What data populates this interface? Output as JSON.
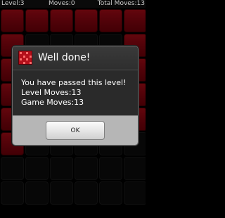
{
  "status_bar": {
    "level": "Level:3",
    "moves": "Moves:0",
    "total_moves": "Total Moves:13"
  },
  "board": {
    "rows": 8,
    "cols": 6,
    "cells": [
      [
        1,
        1,
        1,
        1,
        1,
        1
      ],
      [
        1,
        0,
        0,
        0,
        0,
        1
      ],
      [
        1,
        0,
        0,
        0,
        0,
        1
      ],
      [
        1,
        0,
        0,
        0,
        0,
        1
      ],
      [
        1,
        0,
        0,
        0,
        0,
        1
      ],
      [
        1,
        0,
        0,
        0,
        0,
        0
      ],
      [
        0,
        0,
        0,
        0,
        0,
        0
      ],
      [
        0,
        0,
        0,
        0,
        0,
        0
      ]
    ],
    "colors": {
      "on": "#9e0812",
      "off": "#0e0e0e"
    }
  },
  "dialog": {
    "title": "Well done!",
    "icon": "game-logo-icon",
    "message_lines": [
      "You have passed this level!",
      "Level Moves:13",
      "Game Moves:13"
    ],
    "ok_label": "OK"
  }
}
